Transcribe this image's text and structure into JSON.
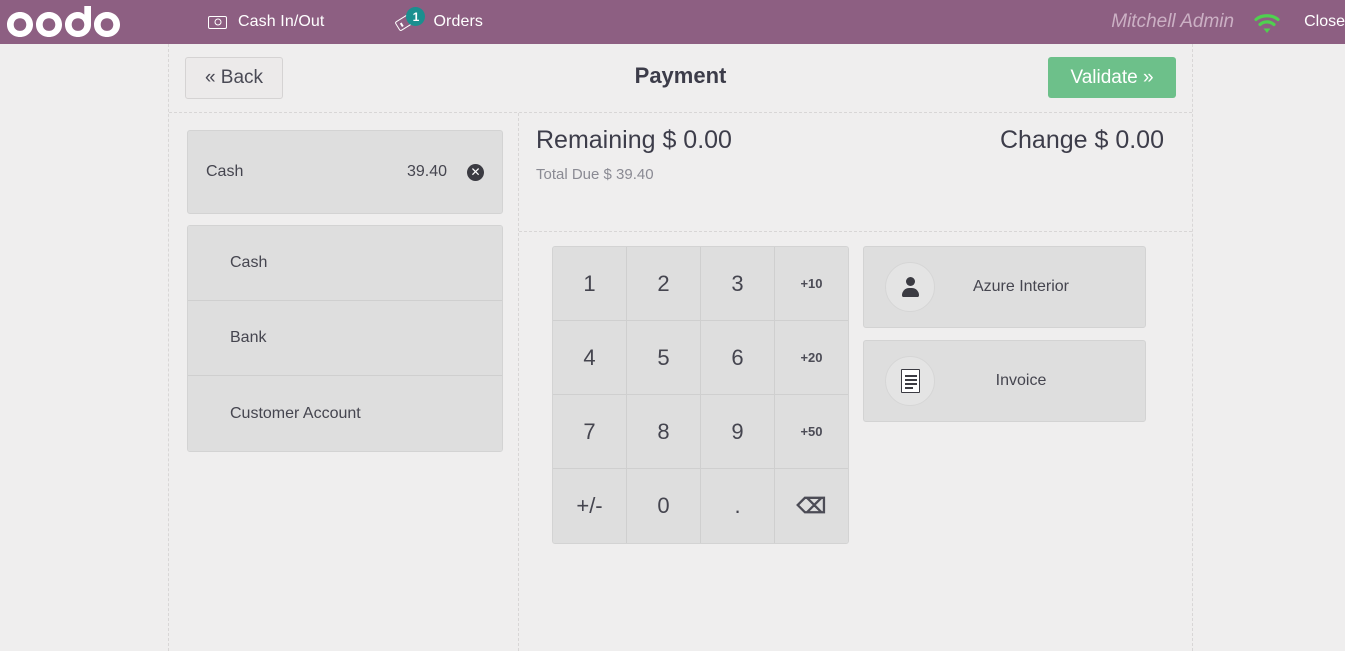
{
  "topbar": {
    "logo_text": "odoo",
    "cash_in_out": {
      "label": "Cash In/Out",
      "icon": "money-icon"
    },
    "orders": {
      "label": "Orders",
      "icon": "ticket-icon",
      "badge": "1"
    },
    "username": "Mitchell Admin",
    "wifi_icon": "wifi-icon",
    "close_label": "Close",
    "bar_color": "#8d5f82",
    "badge_color": "#1a8f8f"
  },
  "screen": {
    "back_label": "« Back",
    "title": "Payment",
    "validate_label": "Validate »",
    "validate_color": "#6dc08a"
  },
  "paymentlines": [
    {
      "name": "Cash",
      "amount": "39.40",
      "delete_icon": "close-circle-icon"
    }
  ],
  "payment_methods": [
    {
      "label": "Cash"
    },
    {
      "label": "Bank"
    },
    {
      "label": "Customer Account"
    }
  ],
  "totals": {
    "remaining": "Remaining $ 0.00",
    "change": "Change $ 0.00",
    "total_due_label": "Total Due",
    "total_due_value": "$ 39.40"
  },
  "numpad": {
    "rows": [
      [
        {
          "label": "1",
          "type": "digit"
        },
        {
          "label": "2",
          "type": "digit"
        },
        {
          "label": "3",
          "type": "digit"
        },
        {
          "label": "+10",
          "type": "preset"
        }
      ],
      [
        {
          "label": "4",
          "type": "digit"
        },
        {
          "label": "5",
          "type": "digit"
        },
        {
          "label": "6",
          "type": "digit"
        },
        {
          "label": "+20",
          "type": "preset"
        }
      ],
      [
        {
          "label": "7",
          "type": "digit"
        },
        {
          "label": "8",
          "type": "digit"
        },
        {
          "label": "9",
          "type": "digit"
        },
        {
          "label": "+50",
          "type": "preset"
        }
      ],
      [
        {
          "label": "+/-",
          "type": "sign"
        },
        {
          "label": "0",
          "type": "digit"
        },
        {
          "label": ".",
          "type": "decimal"
        },
        {
          "label": "⌫",
          "type": "backspace"
        }
      ]
    ]
  },
  "side_actions": [
    {
      "label": "Azure Interior",
      "icon": "person-icon"
    },
    {
      "label": "Invoice",
      "icon": "document-icon"
    }
  ]
}
